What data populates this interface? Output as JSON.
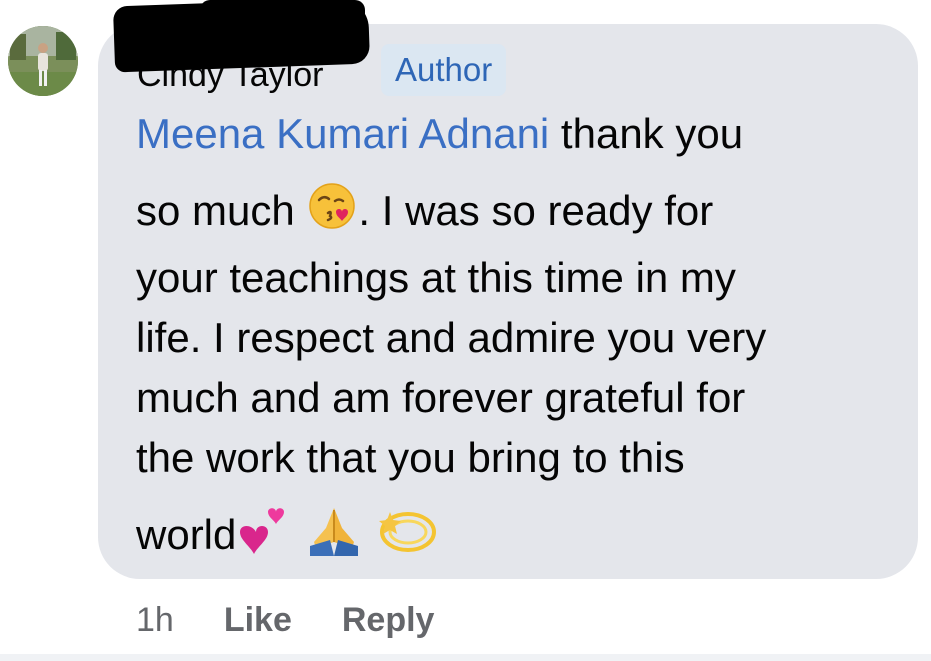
{
  "comment": {
    "author": "Cindy Taylor",
    "author_badge": "Author",
    "mention": "Meena Kumari Adnani",
    "lines": [
      " thank you",
      "so much",
      ". I was so ready for",
      "your teachings at this time in my",
      "life.  I respect and admire you very",
      "much and am forever grateful for",
      "the work that you bring to this",
      "world"
    ],
    "emojis": [
      "kissing-face-with-heart-icon",
      "two-hearts-icon",
      "folded-hands-icon",
      "dizzy-star-icon"
    ]
  },
  "actions": {
    "timestamp": "1h",
    "like_label": "Like",
    "reply_label": "Reply"
  },
  "colors": {
    "bubble": "#e4e6eb",
    "mention": "#3a6fc4",
    "badge_bg": "#dbe7f2",
    "badge_text": "#2e66b6",
    "meta": "#65676b"
  }
}
